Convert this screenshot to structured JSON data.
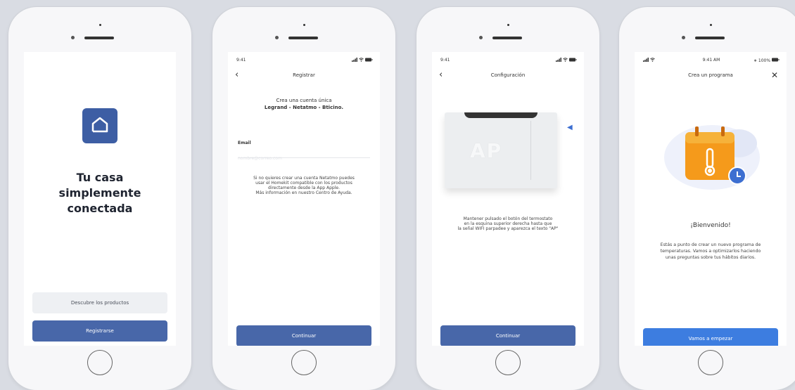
{
  "screens": {
    "welcome": {
      "logo_icon": "house-icon",
      "title_lines": [
        "Tu casa",
        "simplemente",
        "conectada"
      ],
      "discover_label": "Descubre los productos",
      "register_label": "Registrarse",
      "brand_color": "#4867a9"
    },
    "register": {
      "status_time": "9:41",
      "nav_title": "Registrar",
      "heading_line1": "Crea una cuenta única",
      "heading_line2": "Legrand - Netatmo - Bticino.",
      "email_label": "Email",
      "email_placeholder": "nombre@correo.com",
      "info_lines": [
        "Si no quieres crear una cuenta Netatmo puedes",
        "usar el Homekit compatible con los productos",
        "directamente desde la App  Apple.",
        "Más información en nuestro Centro de Ayuda."
      ],
      "continue_label": "Continuar"
    },
    "config": {
      "status_time": "9:41",
      "nav_title": "Configuración",
      "device_display": "AP",
      "instruction_lines": [
        "Mantener pulsado el botón del termostato",
        "en la esquina superior derecha hasta que",
        "la señal WIFI parpadee y aparezca el texto \"AP\""
      ],
      "continue_label": "Continuar"
    },
    "program": {
      "status_time": "9:41 AM",
      "battery": "100%",
      "nav_title": "Crea un programa",
      "welcome_title": "¡Bienvenido!",
      "body_lines": [
        "Estás a punto de crear un nuevo programa de",
        "temperaturas. Vamos a optimizarlos haciendo",
        "unas preguntas sobre tus hábitos diarios."
      ],
      "start_label": "Vamos a empezar"
    }
  }
}
